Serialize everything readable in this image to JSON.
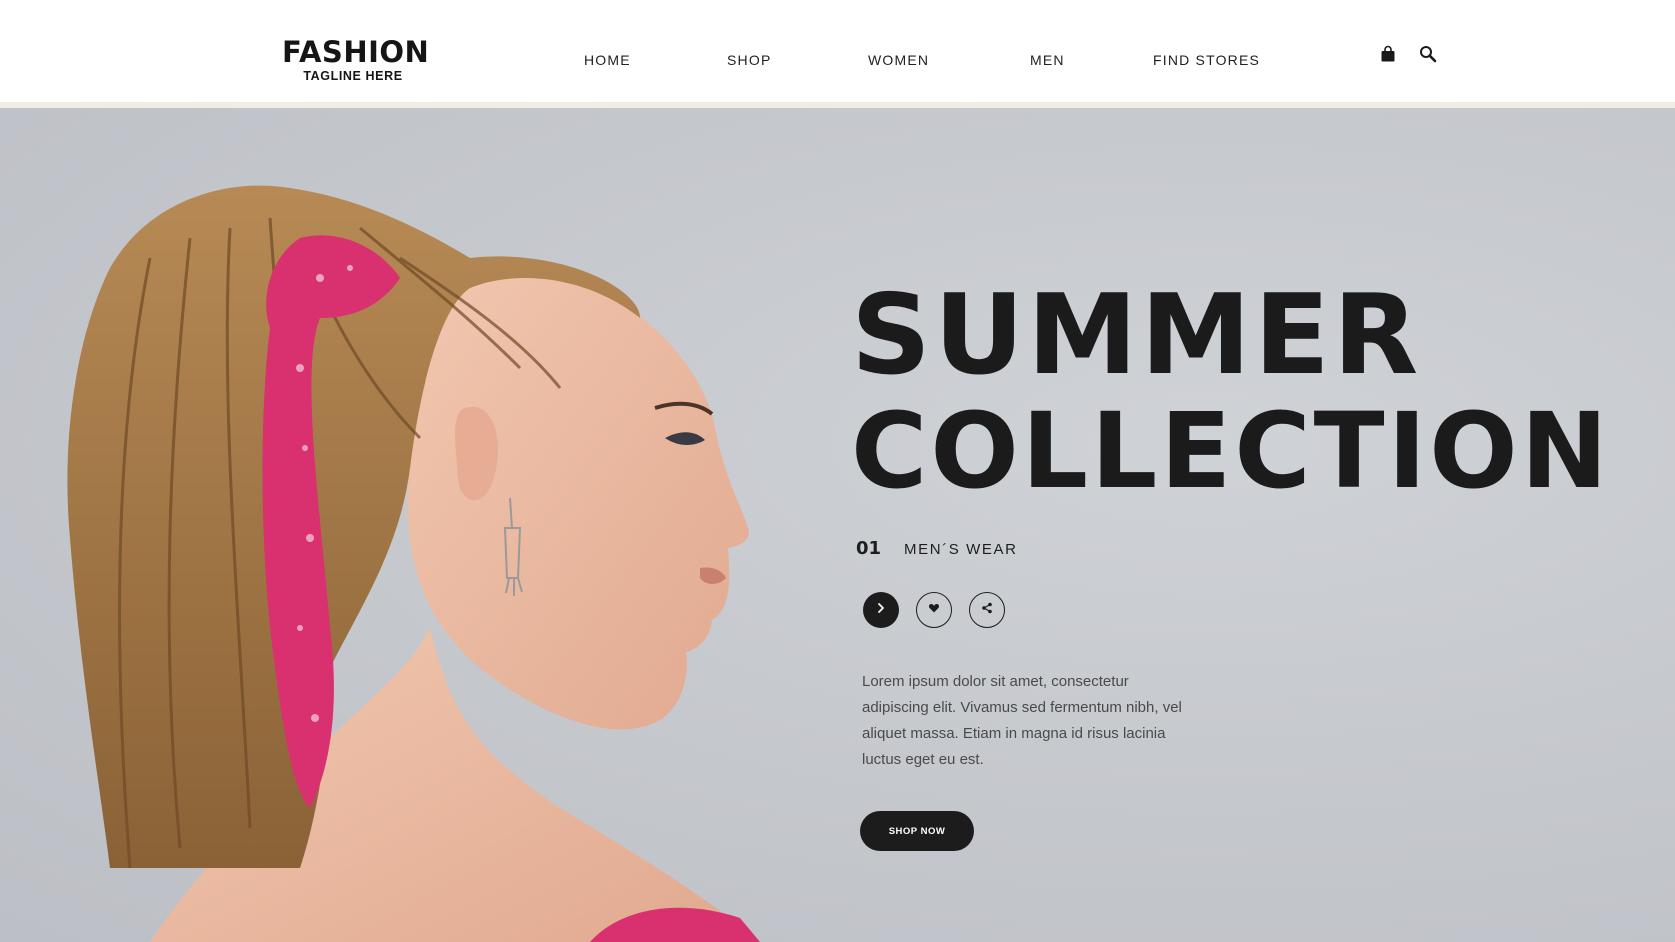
{
  "brand": {
    "name": "FASHION",
    "tagline": "TAGLINE HERE"
  },
  "nav": {
    "items": [
      {
        "label": "HOME"
      },
      {
        "label": "SHOP"
      },
      {
        "label": "WOMEN"
      },
      {
        "label": "MEN"
      },
      {
        "label": "FIND STORES"
      }
    ],
    "icons": [
      "shopping-bag-icon",
      "search-icon"
    ]
  },
  "hero": {
    "headline_line1": "SUMMER",
    "headline_line2": "COLLECTION",
    "index": "01",
    "category": "MEN´S WEAR",
    "action_icons": [
      "chevron-right-icon",
      "heart-icon",
      "share-icon"
    ],
    "description": "Lorem ipsum dolor sit amet, consectetur adipiscing elit. Vivamus sed fermentum nibh, vel aliquet massa. Etiam in magna id risus lacinia luctus eget eu est.",
    "cta_label": "SHOP NOW"
  },
  "colors": {
    "background": "#ffffff",
    "header_strip": "#f1ede4",
    "hero_background": "#c6c9ce",
    "text_dark": "#1b1b1b",
    "button_dark": "#1c1c1c",
    "scarf_pink": "#d9306f"
  }
}
